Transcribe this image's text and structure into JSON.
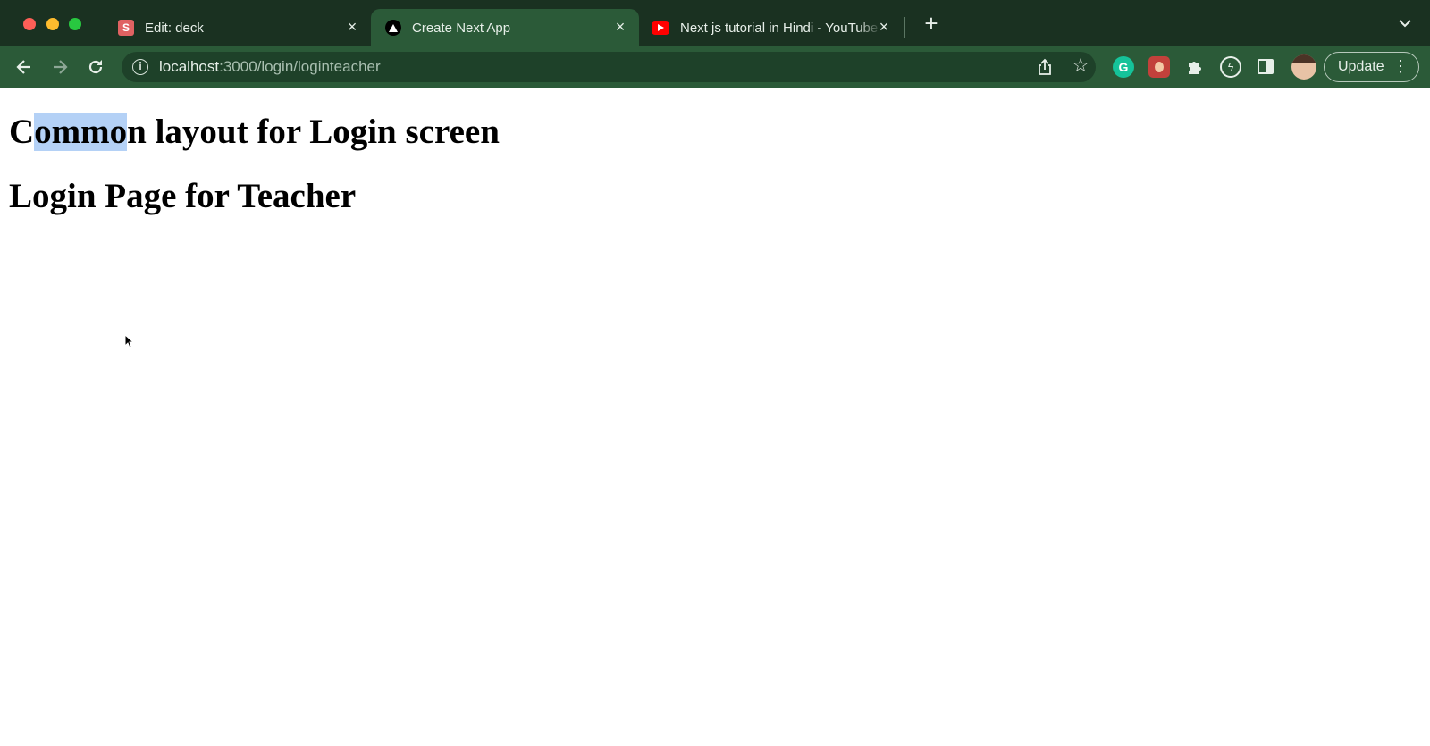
{
  "browser": {
    "tabs": [
      {
        "title": "Edit: deck",
        "favicon": "slides-icon",
        "favicon_letter": "S",
        "active": false
      },
      {
        "title": "Create Next App",
        "favicon": "nextjs-icon",
        "active": true
      },
      {
        "title": "Next js tutorial in Hindi - YouTube",
        "favicon": "youtube-icon",
        "active": false
      }
    ],
    "url": {
      "host": "localhost",
      "path": ":3000/login/loginteacher"
    },
    "extensions": [
      "grammarly-icon",
      "bug-extension-icon",
      "puzzle-icon",
      "bolt-icon"
    ],
    "update_label": "Update"
  },
  "page": {
    "heading_layout_prefix": "C",
    "heading_layout_selected": "ommo",
    "heading_layout_suffix": "n layout for Login screen",
    "heading_page": "Login Page for Teacher"
  },
  "colors": {
    "tabstrip": "#1a3121",
    "toolbar": "#2b5a38",
    "selection": "#b4d1f6"
  }
}
